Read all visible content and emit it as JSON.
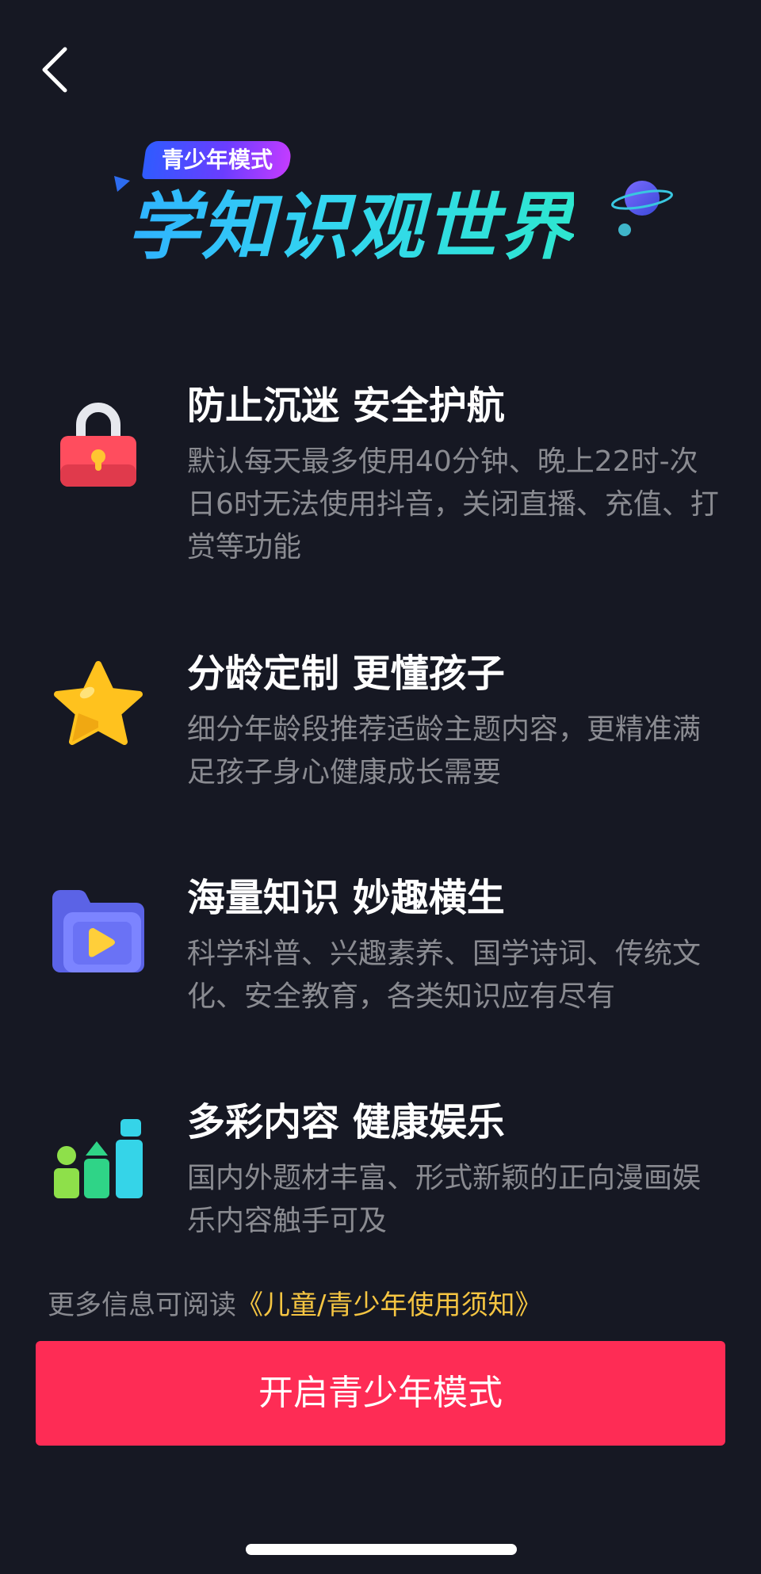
{
  "banner": {
    "badge": "青少年模式",
    "headline": "学知识观世界"
  },
  "features": [
    {
      "icon": "lock-icon",
      "title": "防止沉迷 安全护航",
      "desc": "默认每天最多使用40分钟、晚上22时-次日6时无法使用抖音，关闭直播、充值、打赏等功能"
    },
    {
      "icon": "star-icon",
      "title": "分龄定制 更懂孩子",
      "desc": "细分年龄段推荐适龄主题内容，更精准满足孩子身心健康成长需要"
    },
    {
      "icon": "video-folder-icon",
      "title": "海量知识 妙趣横生",
      "desc": "科学科普、兴趣素养、国学诗词、传统文化、安全教育，各类知识应有尽有"
    },
    {
      "icon": "bar-blocks-icon",
      "title": "多彩内容 健康娱乐",
      "desc": "国内外题材丰富、形式新颖的正向漫画娱乐内容触手可及"
    }
  ],
  "info": {
    "prefix": "更多信息可阅读",
    "link": "《儿童/青少年使用须知》"
  },
  "enable_button": "开启青少年模式",
  "colors": {
    "background": "#161823",
    "primary_button": "#fe2c55",
    "link": "#f5c542",
    "secondary_text": "#8a8b91"
  }
}
